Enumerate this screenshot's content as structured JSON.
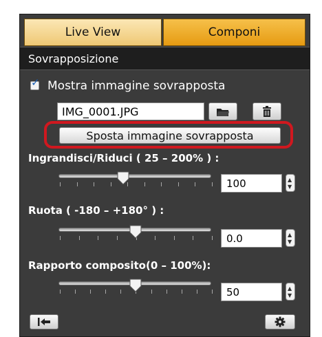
{
  "tabs": {
    "live_view": "Live View",
    "compose": "Componi"
  },
  "section": {
    "title": "Sovrapposizione"
  },
  "overlay": {
    "show_label": "Mostra immagine sovrapposta",
    "show_checked": true,
    "filename": "IMG_0001.JPG",
    "folder_icon": "folder-icon",
    "trash_icon": "trash-icon",
    "move_button": "Sposta immagine sovrapposta"
  },
  "zoom": {
    "label": "Ingrandisci/Riduci ( 25 – 200% ) :",
    "value": "100",
    "min": 25,
    "max": 200
  },
  "rotate": {
    "label": "Ruota ( -180 – +180° ) :",
    "value": "0.0",
    "min": -180,
    "max": 180
  },
  "composite": {
    "label": "Rapporto composito(0 – 100%):",
    "value": "50",
    "min": 0,
    "max": 100
  },
  "footer": {
    "reset_icon": "reset-icon",
    "settings_icon": "gear-icon"
  },
  "colors": {
    "tab_active": "#e69b12",
    "tab_inactive": "#f2d18a",
    "highlight": "#d0181f",
    "panel": "#3b3b3b"
  }
}
